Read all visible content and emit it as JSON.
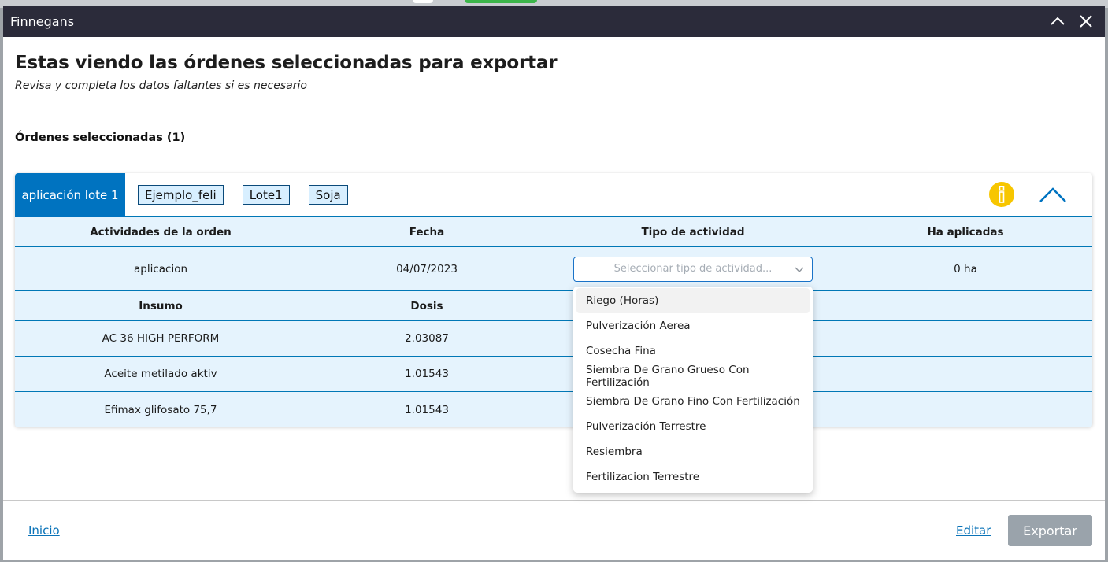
{
  "window": {
    "title": "Finnegans",
    "collapse_icon": "chevron-up-icon",
    "close_icon": "close-icon"
  },
  "header": {
    "title": "Estas viendo las órdenes seleccionadas para exportar",
    "subtitle": "Revisa y completa los datos faltantes si es necesario",
    "selected_label": "Órdenes seleccionadas (1)"
  },
  "order": {
    "tab_label": "aplicación lote 1",
    "chips": [
      "Ejemplo_feli",
      "Lote1",
      "Soja"
    ],
    "info_icon": "info-icon",
    "collapse_icon": "chevron-up-icon",
    "columns": [
      "Actividades de la orden",
      "Fecha",
      "Tipo de actividad",
      "Ha aplicadas"
    ],
    "activity": {
      "name": "aplicacion",
      "date": "04/07/2023",
      "type_placeholder": "Seleccionar tipo de actividad...",
      "ha": "0 ha"
    },
    "input_columns": [
      "Insumo",
      "Dosis"
    ],
    "inputs": [
      {
        "name": "AC 36 HIGH PERFORM",
        "dose": "2.03087"
      },
      {
        "name": "Aceite metilado aktiv",
        "dose": "1.01543"
      },
      {
        "name": "Efimax glifosato 75,7",
        "dose": "1.01543"
      }
    ]
  },
  "dropdown": {
    "options": [
      "Riego (Horas)",
      "Pulverización Aerea",
      "Cosecha Fina",
      "Siembra De Grano Grueso Con Fertilización",
      "Siembra De Grano Fino Con Fertilización",
      "Pulverización Terrestre",
      "Resiembra",
      "Fertilizacion Terrestre"
    ],
    "highlighted_index": 0
  },
  "footer": {
    "home_label": "Inicio",
    "edit_label": "Editar",
    "export_label": "Exportar"
  },
  "colors": {
    "titlebar": "#2b2b3a",
    "accent": "#0073c0",
    "row_bg": "#e5f3fd",
    "info": "#f7c600",
    "export_disabled": "#9aa3ab"
  }
}
